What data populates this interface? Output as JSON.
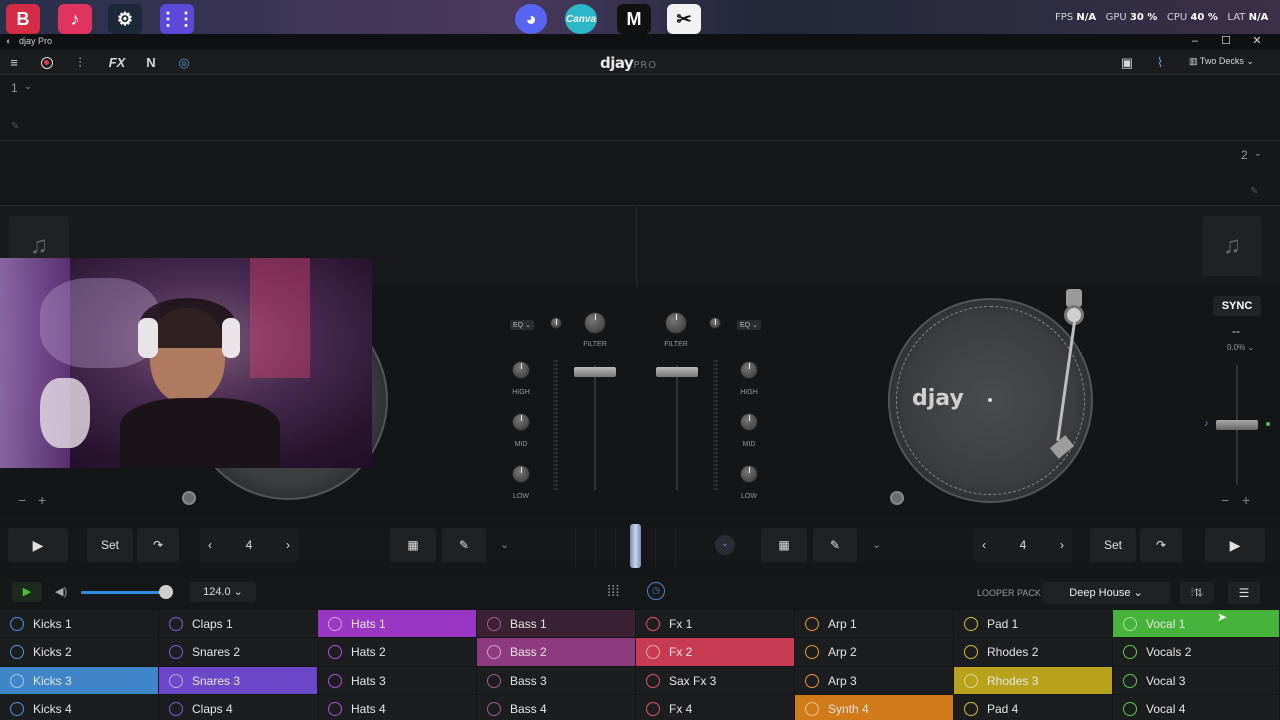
{
  "stats": {
    "fps_label": "FPS",
    "fps": "N/A",
    "gpu_label": "GPU",
    "gpu": "30 %",
    "cpu_label": "CPU",
    "cpu": "40 %",
    "lat_label": "LAT",
    "lat": "N/A"
  },
  "window": {
    "title": "djay Pro",
    "minimize": "–",
    "maximize": "☐",
    "close": "✕"
  },
  "toolbar": {
    "logo_main": "djay",
    "logo_sub": "PRO",
    "fx": "FX",
    "n": "N",
    "layout": "Two Decks"
  },
  "lanes": {
    "deck1_num": "1",
    "deck2_num": "2"
  },
  "deck_right": {
    "sync": "SYNC",
    "dashes": "--",
    "pitch": "0.0%",
    "platter_label": "djay"
  },
  "mixer": {
    "eq_left": "EQ",
    "eq_right": "EQ",
    "filter_left": "FILTER",
    "filter_right": "FILTER",
    "high": "HIGH",
    "mid": "MID",
    "low": "LOW"
  },
  "transport": {
    "left_set": "Set",
    "left_loop": "4",
    "right_set": "Set",
    "right_loop": "4"
  },
  "looper": {
    "bpm": "124.0",
    "pack_label": "LOOPER PACK",
    "pack_name": "Deep House"
  },
  "grid": {
    "columns": [
      {
        "color": "#3f86c9",
        "ring": "#4a98e0",
        "items": [
          "Kicks 1",
          "Kicks 2",
          "Kicks 3",
          "Kicks 4"
        ],
        "active": 2
      },
      {
        "color": "#6a48c8",
        "ring": "#7b5ce0",
        "items": [
          "Claps 1",
          "Snares 2",
          "Snares 3",
          "Claps 4"
        ],
        "active": 2
      },
      {
        "color": "#9a36c4",
        "ring": "#b050d8",
        "items": [
          "Hats 1",
          "Hats 2",
          "Hats 3",
          "Hats 4"
        ],
        "active": 0
      },
      {
        "color": "#8e3a7e",
        "ring": "#a8589a",
        "items": [
          "Bass 1",
          "Bass 2",
          "Bass 3",
          "Bass 4"
        ],
        "active": 1,
        "dim": 0
      },
      {
        "color": "#c83c52",
        "ring": "#e05468",
        "items": [
          "Fx 1",
          "Fx 2",
          "Sax Fx 3",
          "Fx 4"
        ],
        "active": 1
      },
      {
        "color": "#d07a1a",
        "ring": "#e69630",
        "items": [
          "Arp 1",
          "Arp 2",
          "Arp 3",
          "Synth 4"
        ],
        "active": 3
      },
      {
        "color": "#b8a21c",
        "ring": "#d4bc30",
        "items": [
          "Pad 1",
          "Rhodes 2",
          "Rhodes 3",
          "Pad 4"
        ],
        "active": 2
      },
      {
        "color": "#46b43a",
        "ring": "#5ccc4e",
        "items": [
          "Vocal 1",
          "Vocals 2",
          "Vocal 3",
          "Vocal 4"
        ],
        "active": 0
      }
    ]
  },
  "icons": {
    "menu": "menu-icon",
    "record": "record-icon",
    "fx": "fx-icon",
    "n": "n-icon",
    "play": "play-icon",
    "loop": "loop-icon",
    "grid": "grid-icon"
  }
}
